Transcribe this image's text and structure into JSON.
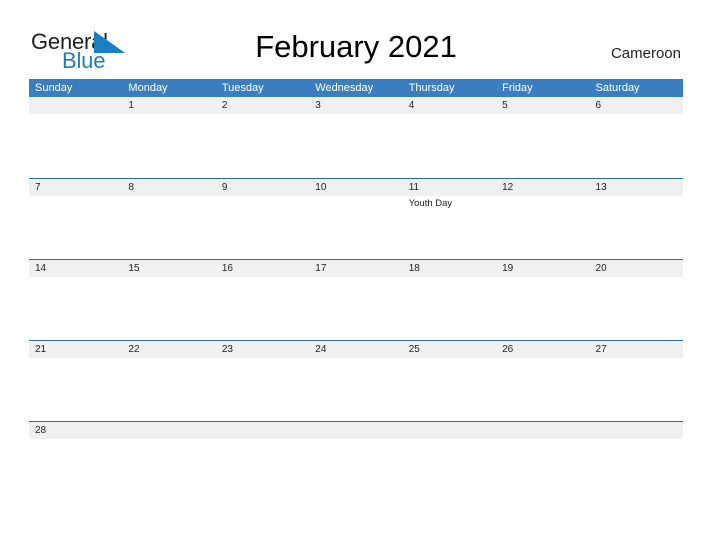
{
  "brand": {
    "name_part1": "General",
    "name_part2": "Blue",
    "flag_icon": "blue-triangle-flag-icon",
    "color_dark": "#231f20",
    "color_blue": "#1b7fc4"
  },
  "header": {
    "title": "February 2021",
    "country": "Cameroon"
  },
  "theme": {
    "header_blue": "#3b7ebf",
    "row_border_blue": "#2b6ca3",
    "band_gray": "#f0f0f0",
    "text_dark": "#231f20",
    "text_white": "#ffffff"
  },
  "calendar": {
    "month": "February",
    "year": "2021",
    "weekdays": [
      "Sunday",
      "Monday",
      "Tuesday",
      "Wednesday",
      "Thursday",
      "Friday",
      "Saturday"
    ],
    "weeks": [
      {
        "days": [
          {
            "num": "",
            "event": ""
          },
          {
            "num": "1",
            "event": ""
          },
          {
            "num": "2",
            "event": ""
          },
          {
            "num": "3",
            "event": ""
          },
          {
            "num": "4",
            "event": ""
          },
          {
            "num": "5",
            "event": ""
          },
          {
            "num": "6",
            "event": ""
          }
        ]
      },
      {
        "days": [
          {
            "num": "7",
            "event": ""
          },
          {
            "num": "8",
            "event": ""
          },
          {
            "num": "9",
            "event": ""
          },
          {
            "num": "10",
            "event": ""
          },
          {
            "num": "11",
            "event": "Youth Day"
          },
          {
            "num": "12",
            "event": ""
          },
          {
            "num": "13",
            "event": ""
          }
        ]
      },
      {
        "days": [
          {
            "num": "14",
            "event": ""
          },
          {
            "num": "15",
            "event": ""
          },
          {
            "num": "16",
            "event": ""
          },
          {
            "num": "17",
            "event": ""
          },
          {
            "num": "18",
            "event": ""
          },
          {
            "num": "19",
            "event": ""
          },
          {
            "num": "20",
            "event": ""
          }
        ]
      },
      {
        "days": [
          {
            "num": "21",
            "event": ""
          },
          {
            "num": "22",
            "event": ""
          },
          {
            "num": "23",
            "event": ""
          },
          {
            "num": "24",
            "event": ""
          },
          {
            "num": "25",
            "event": ""
          },
          {
            "num": "26",
            "event": ""
          },
          {
            "num": "27",
            "event": ""
          }
        ]
      },
      {
        "days": [
          {
            "num": "28",
            "event": ""
          },
          {
            "num": "",
            "event": ""
          },
          {
            "num": "",
            "event": ""
          },
          {
            "num": "",
            "event": ""
          },
          {
            "num": "",
            "event": ""
          },
          {
            "num": "",
            "event": ""
          },
          {
            "num": "",
            "event": ""
          }
        ]
      }
    ]
  }
}
